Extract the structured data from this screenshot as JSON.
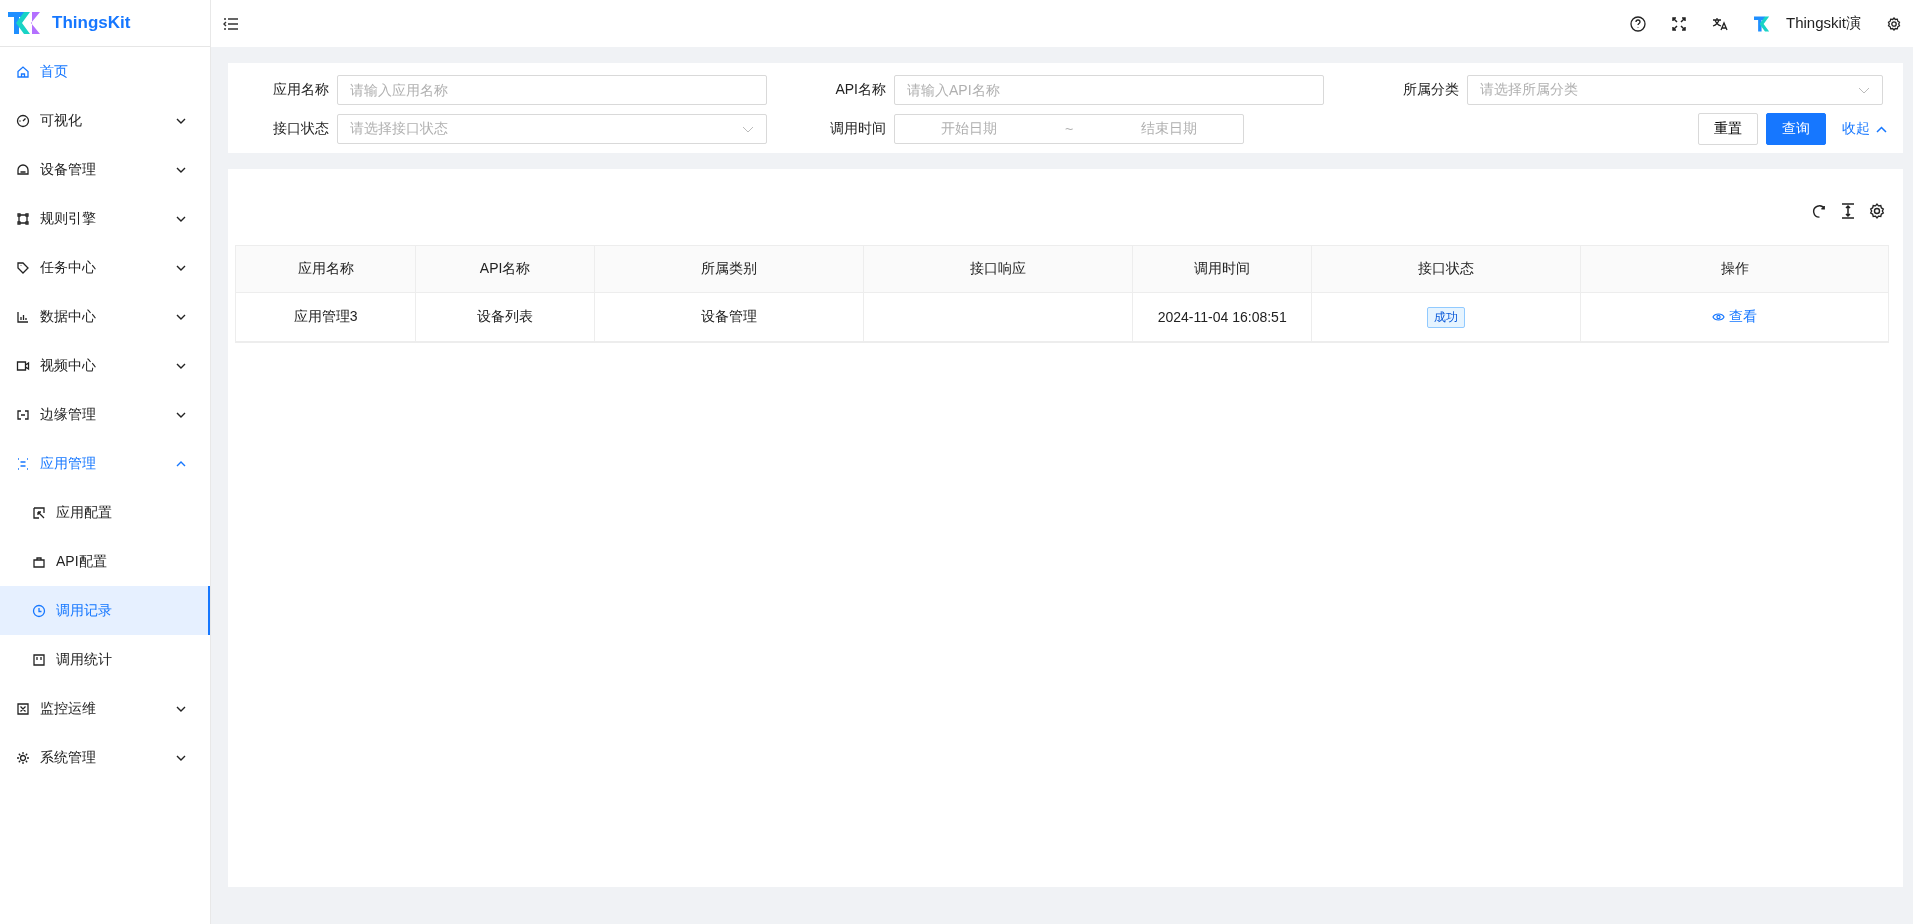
{
  "brand": {
    "name": "ThingsKit"
  },
  "header": {
    "user": "Thingskit演"
  },
  "sidebar": {
    "items": [
      {
        "label": "首页",
        "selected": true
      },
      {
        "label": "可视化",
        "selected": false,
        "expanded": false
      },
      {
        "label": "设备管理",
        "selected": false,
        "expanded": false
      },
      {
        "label": "规则引擎",
        "selected": false,
        "expanded": false
      },
      {
        "label": "任务中心",
        "selected": false,
        "expanded": false
      },
      {
        "label": "数据中心",
        "selected": false,
        "expanded": false
      },
      {
        "label": "视频中心",
        "selected": false,
        "expanded": false
      },
      {
        "label": "边缘管理",
        "selected": false,
        "expanded": false
      },
      {
        "label": "应用管理",
        "selected": true,
        "expanded": true,
        "children": [
          {
            "label": "应用配置",
            "selected": false
          },
          {
            "label": "API配置",
            "selected": false
          },
          {
            "label": "调用记录",
            "selected": true
          },
          {
            "label": "调用统计",
            "selected": false
          }
        ]
      },
      {
        "label": "监控运维",
        "selected": false,
        "expanded": false
      },
      {
        "label": "系统管理",
        "selected": false,
        "expanded": false
      }
    ]
  },
  "filters": {
    "app_name": {
      "label": "应用名称",
      "placeholder": "请输入应用名称"
    },
    "api_name": {
      "label": "API名称",
      "placeholder": "请输入API名称"
    },
    "category": {
      "label": "所属分类",
      "placeholder": "请选择所属分类"
    },
    "status": {
      "label": "接口状态",
      "placeholder": "请选择接口状态"
    },
    "time": {
      "label": "调用时间",
      "start_placeholder": "开始日期",
      "separator": "~",
      "end_placeholder": "结束日期"
    },
    "reset": "重置",
    "search": "查询",
    "collapse": "收起"
  },
  "table": {
    "columns": [
      "应用名称",
      "API名称",
      "所属类别",
      "接口响应",
      "调用时间",
      "接口状态",
      "操作"
    ],
    "rows": [
      {
        "app": "应用管理3",
        "api": "设备列表",
        "category": "设备管理",
        "time": "2024-11-04 16:08:51",
        "status": "成功",
        "action": "查看"
      }
    ]
  }
}
